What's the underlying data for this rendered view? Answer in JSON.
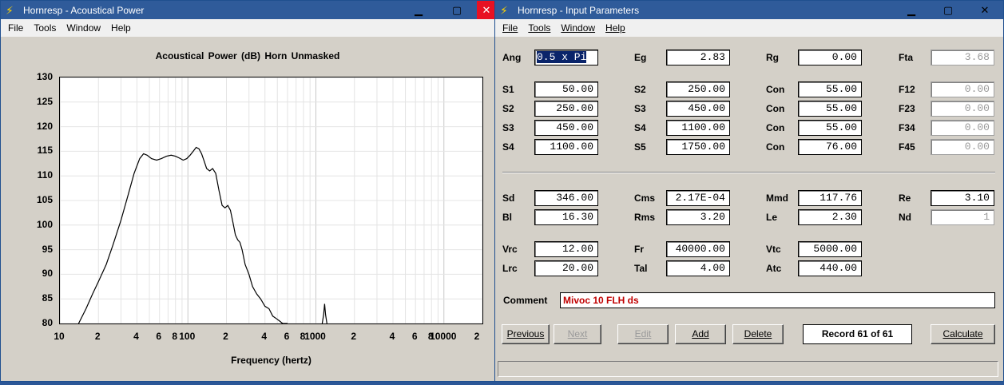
{
  "windows": {
    "acoustical_power": {
      "title": "Hornresp - Acoustical Power",
      "menu": [
        "File",
        "Tools",
        "Window",
        "Help"
      ]
    },
    "input_parameters": {
      "title": "Hornresp - Input Parameters",
      "menu": [
        "File",
        "Tools",
        "Window",
        "Help"
      ]
    }
  },
  "icons": {
    "app": "lightning-bolt-icon",
    "minimize": "minimize-icon",
    "maximize": "maximize-icon",
    "close": "close-icon"
  },
  "chart_data": {
    "type": "line",
    "title": "Acoustical Power (dB)   Horn   Unmasked",
    "xlabel": "Frequency (hertz)",
    "ylabel": "",
    "x_scale": "log",
    "xlim": [
      10,
      20000
    ],
    "ylim": [
      80,
      130
    ],
    "grid": true,
    "yticks": [
      "130",
      "125",
      "120",
      "115",
      "110",
      "105",
      "100",
      "95",
      "90",
      "85",
      "80"
    ],
    "xticks": [
      "10",
      "2",
      "4",
      "6",
      "8",
      "100",
      "2",
      "4",
      "6",
      "8",
      "1000",
      "2",
      "4",
      "6",
      "8",
      "10000",
      "2"
    ],
    "series": [
      {
        "name": "",
        "color": "#000000",
        "x": [
          14,
          16,
          18,
          20,
          23,
          26,
          30,
          34,
          38,
          42,
          45,
          48,
          52,
          57,
          62,
          68,
          74,
          80,
          86,
          92,
          98,
          104,
          110,
          116,
          122,
          128,
          134,
          140,
          148,
          156,
          165,
          175,
          185,
          195,
          205,
          215,
          225,
          235,
          245,
          255,
          265,
          280,
          300,
          320,
          345,
          370,
          400,
          430,
          460,
          490,
          520,
          550,
          580,
          600
        ],
        "y": [
          80,
          83,
          86,
          88.5,
          92,
          96,
          101,
          106,
          110.5,
          113.5,
          114.5,
          114.2,
          113.5,
          113.2,
          113.5,
          114,
          114.2,
          114,
          113.6,
          113.2,
          113.5,
          114.2,
          115,
          115.8,
          115.5,
          114.5,
          113,
          111.5,
          111,
          111.5,
          110.5,
          107,
          104,
          103.5,
          104,
          103,
          100.5,
          98,
          97,
          96.5,
          95,
          92,
          90,
          87.5,
          86,
          85,
          83.5,
          83,
          81.5,
          81,
          80.5,
          80,
          80,
          80
        ]
      },
      {
        "name": "",
        "color": "#000000",
        "x": [
          1120,
          1150,
          1170,
          1190,
          1220
        ],
        "y": [
          80,
          81.8,
          84,
          81.8,
          80
        ]
      }
    ]
  },
  "params": {
    "row_ang": [
      {
        "label": "Ang",
        "value": "0.5 x Pi",
        "selected": true
      },
      {
        "label": "Eg",
        "value": "2.83"
      },
      {
        "label": "Rg",
        "value": "0.00"
      },
      {
        "label": "Fta",
        "value": "3.68",
        "dim": true
      }
    ],
    "segments": [
      [
        {
          "label": "S1",
          "value": "50.00"
        },
        {
          "label": "S2",
          "value": "250.00"
        },
        {
          "label": "Con",
          "value": "55.00"
        },
        {
          "label": "F12",
          "value": "0.00",
          "dim": true
        }
      ],
      [
        {
          "label": "S2",
          "value": "250.00"
        },
        {
          "label": "S3",
          "value": "450.00"
        },
        {
          "label": "Con",
          "value": "55.00"
        },
        {
          "label": "F23",
          "value": "0.00",
          "dim": true
        }
      ],
      [
        {
          "label": "S3",
          "value": "450.00"
        },
        {
          "label": "S4",
          "value": "1100.00"
        },
        {
          "label": "Con",
          "value": "55.00"
        },
        {
          "label": "F34",
          "value": "0.00",
          "dim": true
        }
      ],
      [
        {
          "label": "S4",
          "value": "1100.00"
        },
        {
          "label": "S5",
          "value": "1750.00"
        },
        {
          "label": "Con",
          "value": "76.00"
        },
        {
          "label": "F45",
          "value": "0.00",
          "dim": true
        }
      ]
    ],
    "driver": [
      [
        {
          "label": "Sd",
          "value": "346.00"
        },
        {
          "label": "Cms",
          "value": "2.17E-04"
        },
        {
          "label": "Mmd",
          "value": "117.76"
        },
        {
          "label": "Re",
          "value": "3.10"
        }
      ],
      [
        {
          "label": "Bl",
          "value": "16.30"
        },
        {
          "label": "Rms",
          "value": "3.20"
        },
        {
          "label": "Le",
          "value": "2.30"
        },
        {
          "label": "Nd",
          "value": "1",
          "dim": true
        }
      ]
    ],
    "chambers": [
      [
        {
          "label": "Vrc",
          "value": "12.00"
        },
        {
          "label": "Fr",
          "value": "40000.00"
        },
        {
          "label": "Vtc",
          "value": "5000.00"
        }
      ],
      [
        {
          "label": "Lrc",
          "value": "20.00"
        },
        {
          "label": "Tal",
          "value": "4.00"
        },
        {
          "label": "Atc",
          "value": "440.00"
        }
      ]
    ]
  },
  "comment": {
    "label": "Comment",
    "value": "Mivoc 10 FLH ds"
  },
  "buttons": {
    "previous": "Previous",
    "next": "Next",
    "edit": "Edit",
    "add": "Add",
    "delete": "Delete",
    "calculate": "Calculate"
  },
  "record": "Record 61 of 61"
}
